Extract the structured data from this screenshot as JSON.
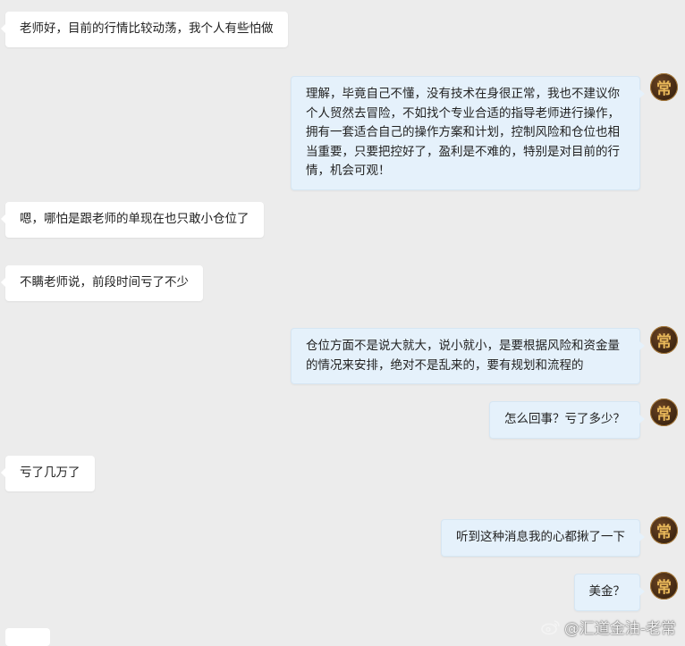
{
  "messages": [
    {
      "side": "in",
      "text": "老师好，目前的行情比较动荡，我个人有些怕做"
    },
    {
      "side": "out",
      "text": "理解，毕竟自己不懂，没有技术在身很正常，我也不建议你个人贸然去冒险，不如找个专业合适的指导老师进行操作，拥有一套适合自己的操作方案和计划，控制风险和仓位也相当重要，只要把控好了，盈利是不难的，特别是对目前的行情，机会可观！"
    },
    {
      "side": "in",
      "text": "嗯，哪怕是跟老师的单现在也只敢小仓位了"
    },
    {
      "side": "in",
      "text": "不瞒老师说，前段时间亏了不少"
    },
    {
      "side": "out",
      "text": "仓位方面不是说大就大，说小就小，是要根据风险和资金量的情况来安排，绝对不是乱来的，要有规划和流程的"
    },
    {
      "side": "out",
      "text": "怎么回事？亏了多少？"
    },
    {
      "side": "in",
      "text": "亏了几万了"
    },
    {
      "side": "out",
      "text": "听到这种消息我的心都揪了一下"
    },
    {
      "side": "out",
      "text": "美金？"
    }
  ],
  "avatar": {
    "char": "常",
    "icon": "brand-calligraphy-avatar"
  },
  "watermark": {
    "text": "@汇道金油-老常",
    "icon": "weibo-icon"
  },
  "colors": {
    "background": "#ececec",
    "incoming_bubble": "#ffffff",
    "outgoing_bubble": "#e5f1fb",
    "avatar_bg": "#3e2612",
    "avatar_text": "#e8b85a"
  }
}
